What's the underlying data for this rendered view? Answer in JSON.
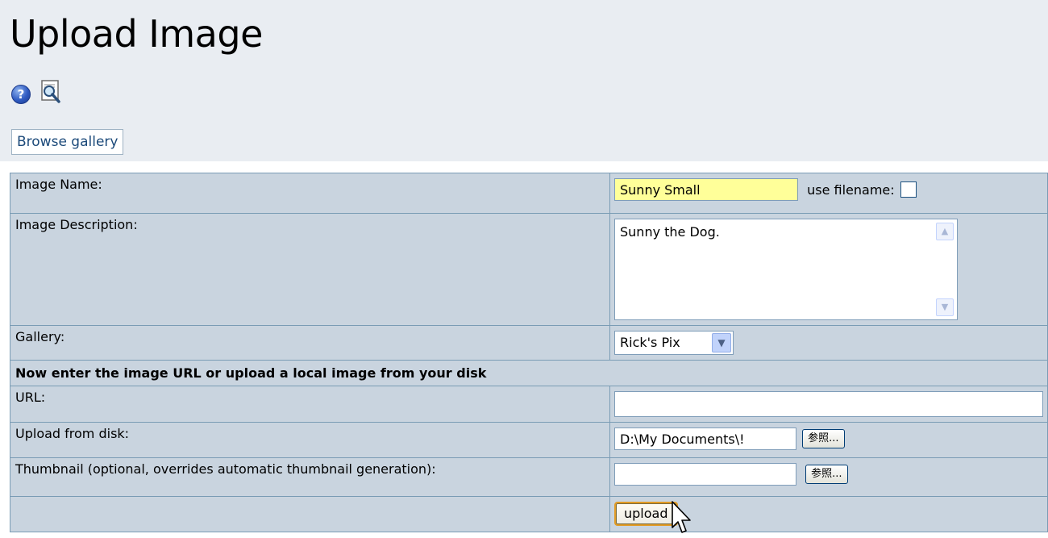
{
  "page": {
    "title": "Upload Image",
    "browse_gallery_label": "Browse gallery"
  },
  "icons": {
    "help": "help-icon",
    "zoom": "magnifier-icon"
  },
  "form": {
    "image_name": {
      "label": "Image Name:",
      "value": "Sunny Small",
      "use_filename_label": "use filename:",
      "use_filename_checked": false
    },
    "image_description": {
      "label": "Image Description:",
      "value": "Sunny the Dog."
    },
    "gallery": {
      "label": "Gallery:",
      "selected": "Rick's Pix"
    },
    "section_heading": "Now enter the image URL or upload a local image from your disk",
    "url": {
      "label": "URL:",
      "value": ""
    },
    "upload_from_disk": {
      "label": "Upload from disk:",
      "value": "D:\\My Documents\\!",
      "browse_label": "参照..."
    },
    "thumbnail": {
      "label": "Thumbnail (optional, overrides automatic thumbnail generation):",
      "value": "",
      "browse_label": "参照..."
    },
    "upload_label": "upload"
  },
  "colors": {
    "header_bg": "#e9edf2",
    "table_bg": "#c9d4df",
    "name_input_bg": "#ffff99"
  }
}
